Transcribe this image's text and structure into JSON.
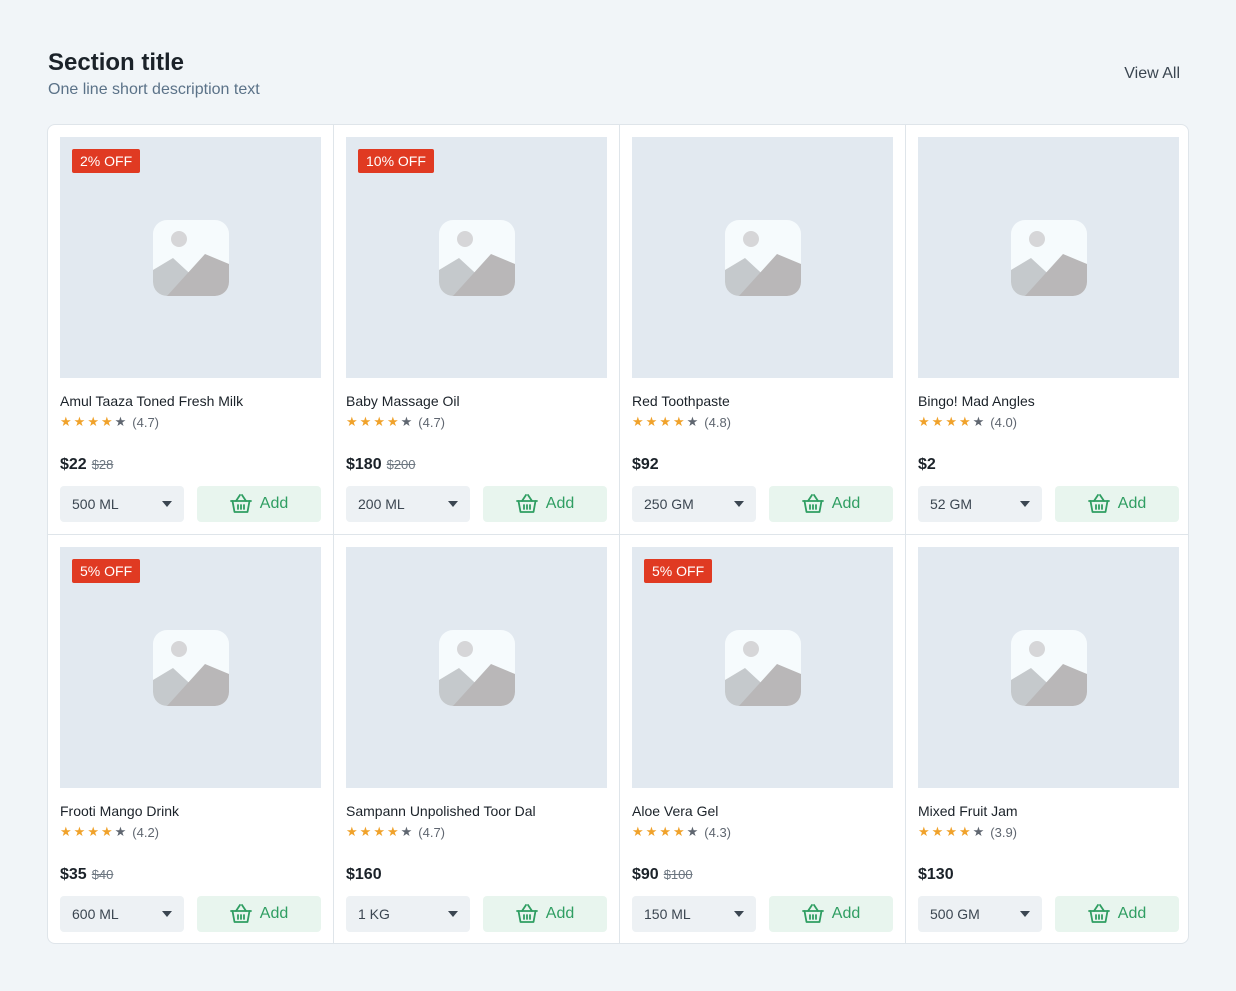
{
  "section": {
    "title": "Section title",
    "description": "One line short description text",
    "view_all_label": "View All"
  },
  "colors": {
    "badge": "#e03a22",
    "star": "#f0a22b",
    "add_button_bg": "#e8f5ee",
    "add_button_text": "#2f9e62",
    "image_placeholder_bg": "#e2e9f0"
  },
  "add_label": "Add",
  "products": [
    {
      "name": "Amul Taaza Toned Fresh Milk",
      "badge": "2% OFF",
      "rating": "(4.7)",
      "stars": 4,
      "price": "$22",
      "mrp": "$28",
      "variant": "500 ML"
    },
    {
      "name": "Baby Massage Oil",
      "badge": "10% OFF",
      "rating": "(4.7)",
      "stars": 4,
      "price": "$180",
      "mrp": "$200",
      "variant": "200 ML"
    },
    {
      "name": "Red Toothpaste",
      "badge": "",
      "rating": "(4.8)",
      "stars": 4,
      "price": "$92",
      "mrp": "",
      "variant": "250 GM"
    },
    {
      "name": "Bingo! Mad Angles",
      "badge": "",
      "rating": "(4.0)",
      "stars": 4,
      "price": "$2",
      "mrp": "",
      "variant": "52 GM"
    },
    {
      "name": "Frooti Mango Drink",
      "badge": "5% OFF",
      "rating": "(4.2)",
      "stars": 4,
      "price": "$35",
      "mrp": "$40",
      "variant": "600 ML"
    },
    {
      "name": "Sampann Unpolished Toor Dal",
      "badge": "",
      "rating": "(4.7)",
      "stars": 4,
      "price": "$160",
      "mrp": "",
      "variant": "1 KG"
    },
    {
      "name": "Aloe Vera Gel",
      "badge": "5% OFF",
      "rating": "(4.3)",
      "stars": 4,
      "price": "$90",
      "mrp": "$100",
      "variant": "150 ML"
    },
    {
      "name": "Mixed Fruit Jam",
      "badge": "",
      "rating": "(3.9)",
      "stars": 4,
      "price": "$130",
      "mrp": "",
      "variant": "500 GM"
    }
  ]
}
